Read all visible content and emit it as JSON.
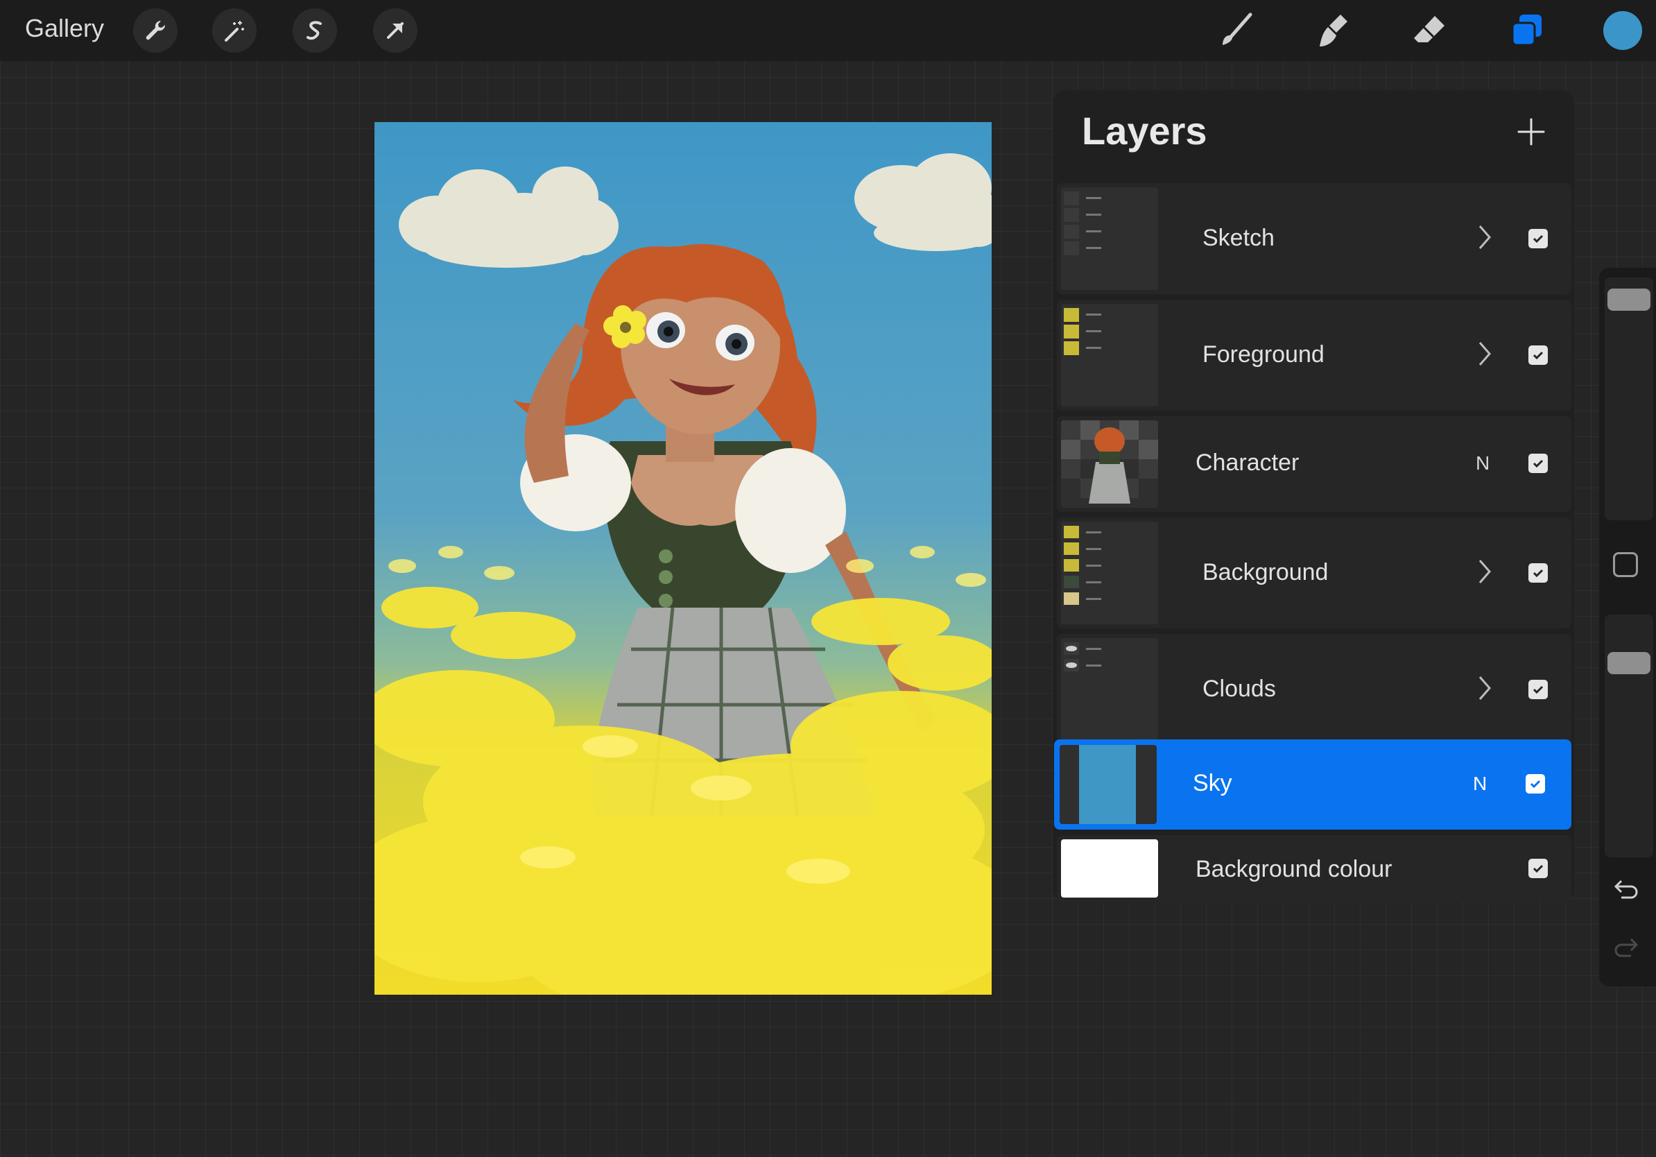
{
  "toolbar": {
    "gallery_label": "Gallery",
    "left_tools": [
      "wrench-icon",
      "magic-wand-icon",
      "selection-s-icon",
      "arrow-transform-icon"
    ],
    "right_tools": [
      "brush-icon",
      "smudge-icon",
      "eraser-icon",
      "layers-icon"
    ],
    "active_color": "#3c95c9"
  },
  "layers": {
    "title": "Layers",
    "add_icon": "plus-icon",
    "items": [
      {
        "name": "Sketch",
        "type": "group",
        "visible": true
      },
      {
        "name": "Foreground",
        "type": "group",
        "visible": true
      },
      {
        "name": "Character",
        "type": "layer",
        "blend": "N",
        "visible": true
      },
      {
        "name": "Background",
        "type": "group",
        "visible": true
      },
      {
        "name": "Clouds",
        "type": "group",
        "visible": true
      },
      {
        "name": "Sky",
        "type": "layer",
        "blend": "N",
        "visible": true,
        "selected": true
      },
      {
        "name": "Background colour",
        "type": "background",
        "visible": true
      }
    ]
  },
  "colors": {
    "accent": "#0a74f0",
    "sky": "#3f97c6",
    "flowers": "#f2dc2a"
  }
}
